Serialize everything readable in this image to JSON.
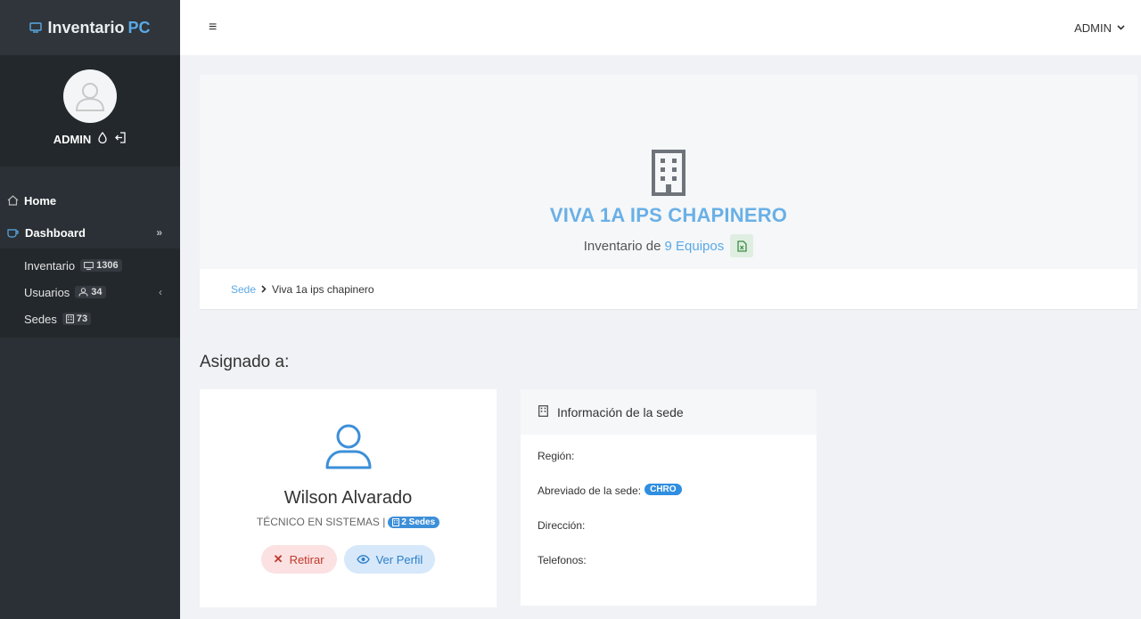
{
  "brand": {
    "part1": "Inventario",
    "part2": "PC"
  },
  "profile": {
    "name": "ADMIN"
  },
  "nav": {
    "home": "Home",
    "dashboard": "Dashboard",
    "sub": [
      {
        "label": "Inventario",
        "count": "1306"
      },
      {
        "label": "Usuarios",
        "count": "34"
      },
      {
        "label": "Sedes",
        "count": "73"
      }
    ]
  },
  "topbar": {
    "user": "ADMIN"
  },
  "hero": {
    "title": "VIVA 1A IPS CHAPINERO",
    "sub_prefix": "Inventario de",
    "sub_count": "9 Equipos"
  },
  "breadcrumb": {
    "link": "Sede",
    "current": "Viva 1a ips chapinero"
  },
  "assigned": {
    "heading": "Asignado a:",
    "name": "Wilson Alvarado",
    "role": "TÉCNICO EN SISTEMAS |",
    "sedes_badge": "2 Sedes",
    "btn_retirar": "Retirar",
    "btn_ver": "Ver Perfil"
  },
  "info": {
    "title": "Información de la sede",
    "region": "Región:",
    "abreviado": "Abreviado de la sede:",
    "abreviado_value": "CHRO",
    "direccion": "Dirección:",
    "telefonos": "Telefonos:"
  },
  "colors": {
    "accent": "#5aa9e6",
    "sidebar": "#2a3035",
    "chip": "#2f8ee0"
  }
}
